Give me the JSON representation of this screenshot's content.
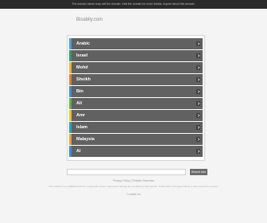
{
  "topbar": {
    "notice": "The domain owner may sell the domain. Visit the domain for more details. Inquire about this domain."
  },
  "site": {
    "domain": "Bisabily.com"
  },
  "links": [
    {
      "label": "Arabic",
      "color": "#4aa3d8"
    },
    {
      "label": "Israel",
      "color": "#2f9e6e"
    },
    {
      "label": "Mohd",
      "color": "#f2b43a"
    },
    {
      "label": "Sheikh",
      "color": "#e0823a"
    },
    {
      "label": "Bin",
      "color": "#3f8fd0"
    },
    {
      "label": "Ali",
      "color": "#6ab04c"
    },
    {
      "label": "Amr",
      "color": "#f2c230"
    },
    {
      "label": "Islam",
      "color": "#2aa6b8"
    },
    {
      "label": "Malaysia",
      "color": "#e9a23b"
    },
    {
      "label": "Al",
      "color": "#3b8fd6"
    }
  ],
  "search": {
    "placeholder": "",
    "button_label": "Search Ads"
  },
  "footer": {
    "privacy": "Privacy Policy | Related Searches",
    "disclaimer": "This website is not affiliated with the trademark owners. Sponsored listings are provided by third parties. Trademarks and logos belong to their respective owners.",
    "contact": "Contact Us"
  }
}
